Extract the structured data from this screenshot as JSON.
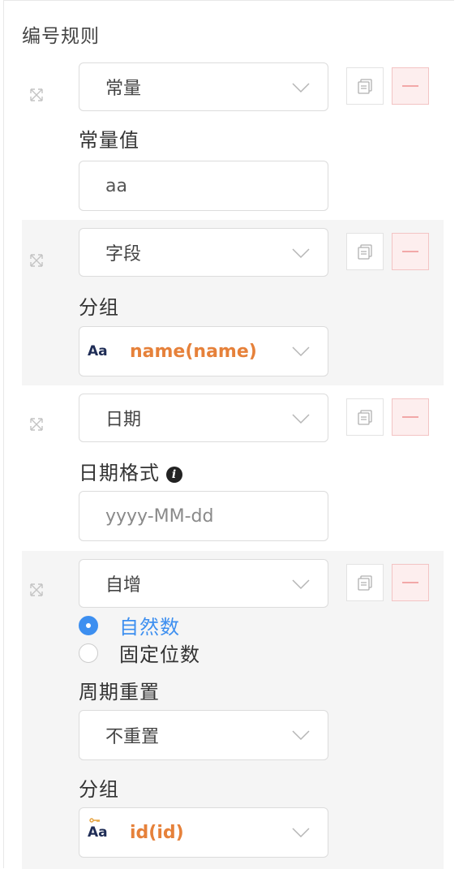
{
  "section_title": "编号规则",
  "rules": [
    {
      "type_select": "常量",
      "field_label": "常量值",
      "input_value": "aa"
    },
    {
      "type_select": "字段",
      "field_label": "分组",
      "field_icon": "Aa",
      "field_value": "name(name)"
    },
    {
      "type_select": "日期",
      "field_label": "日期格式",
      "placeholder": "yyyy-MM-dd"
    },
    {
      "type_select": "自增",
      "radio_options": [
        "自然数",
        "固定位数"
      ],
      "selected_radio": "自然数",
      "reset_label": "周期重置",
      "reset_value": "不重置",
      "group_label": "分组",
      "field_icon": "Aa",
      "field_value": "id(id)"
    }
  ],
  "colors": {
    "accent": "#3d8ff0",
    "field_value": "#e6813a",
    "remove_bg": "#fdeeee"
  },
  "icons": [
    "drag-move-icon",
    "chevron-down-icon",
    "copy-icon",
    "minus-icon",
    "info-icon",
    "key-icon"
  ]
}
